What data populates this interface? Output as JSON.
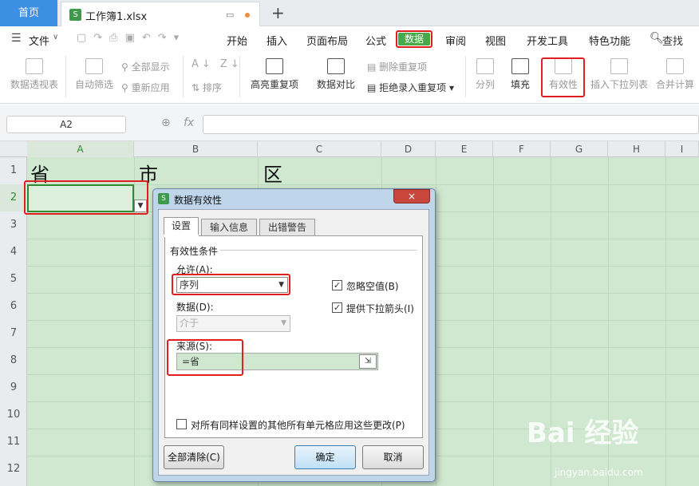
{
  "tabs": {
    "home": "首页",
    "workbook": "工作簿1.xlsx",
    "add": "+"
  },
  "menu": {
    "file": "文件",
    "items": [
      "开始",
      "插入",
      "页面布局",
      "公式",
      "数据",
      "审阅",
      "视图",
      "开发工具",
      "特色功能"
    ],
    "search": "查找"
  },
  "ribbon": {
    "pivot": "数据透视表",
    "autofilter": "自动筛选",
    "showall": "全部显示",
    "reapply": "重新应用",
    "sort": "排序",
    "highlight_dup": "高亮重复项",
    "data_compare": "数据对比",
    "remove_dup": "删除重复项",
    "reject_dup": "拒绝录入重复项",
    "split": "分列",
    "fill": "填充",
    "validity": "有效性",
    "insert_dropdown": "插入下拉列表",
    "consolidate": "合并计算"
  },
  "formula_bar": {
    "name_box": "A2",
    "fx": "fx"
  },
  "grid": {
    "columns": [
      "A",
      "B",
      "C",
      "D",
      "E",
      "F",
      "G",
      "H",
      "I"
    ],
    "rows": [
      "1",
      "2",
      "3",
      "4",
      "5",
      "6",
      "7",
      "8",
      "9",
      "10",
      "11",
      "12"
    ],
    "cells": {
      "A1": "省",
      "B1": "市",
      "C1": "区"
    }
  },
  "dialog": {
    "title": "数据有效性",
    "close": "×",
    "tabs": [
      "设置",
      "输入信息",
      "出错警告"
    ],
    "group": "有效性条件",
    "allow_label": "允许(A):",
    "allow_value": "序列",
    "data_label": "数据(D):",
    "data_value": "介于",
    "ignore_blank": "忽略空值(B)",
    "dropdown_arrow": "提供下拉箭头(I)",
    "source_label": "来源(S):",
    "source_value": "=省",
    "apply_all": "对所有同样设置的其他所有单元格应用这些更改(P)",
    "clear_all": "全部清除(C)",
    "ok": "确定",
    "cancel": "取消"
  },
  "watermark": {
    "logo": "Bai 经验",
    "url": "jingyan.baidu.com"
  },
  "colors": {
    "accent": "#3c8fe2",
    "data_tab": "#48a84a",
    "highlight": "#e02020",
    "sheet_bg": "#cfe8cf"
  }
}
